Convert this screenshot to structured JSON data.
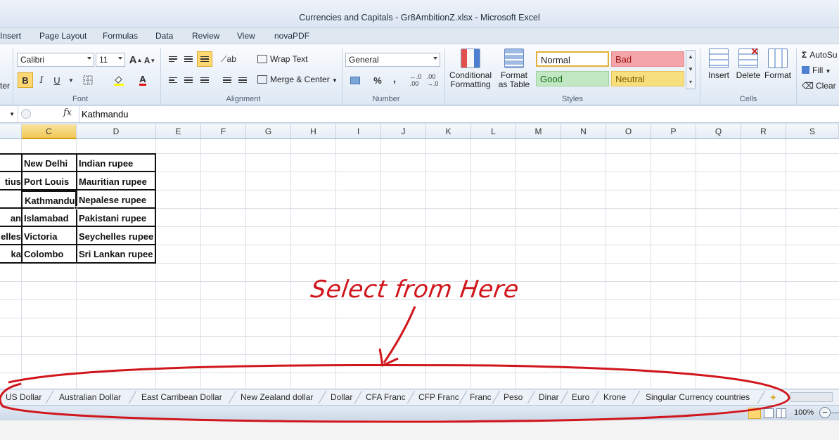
{
  "window": {
    "title": "Currencies and Capitals - Gr8AmbitionZ.xlsx -  Microsoft Excel"
  },
  "tabs": [
    "Insert",
    "Page Layout",
    "Formulas",
    "Data",
    "Review",
    "View",
    "novaPDF"
  ],
  "ribbon": {
    "clipboard_partial": "ter",
    "font": {
      "name": "Calibri",
      "size": "11",
      "group_label": "Font",
      "grow_label": "A",
      "shrink_label": "A",
      "bold": "B",
      "italic": "I",
      "underline": "U",
      "color_letter": "A"
    },
    "alignment": {
      "wrap_text": "Wrap Text",
      "merge_center": "Merge & Center",
      "group_label": "Alignment"
    },
    "number": {
      "format": "General",
      "percent": "%",
      "comma": ",",
      "group_label": "Number"
    },
    "styles": {
      "conditional_formatting": "Conditional\nFormatting",
      "format_as_table": "Format\nas Table",
      "normal": "Normal",
      "bad": "Bad",
      "good": "Good",
      "neutral": "Neutral",
      "group_label": "Styles"
    },
    "cells": {
      "insert": "Insert",
      "delete": "Delete",
      "format": "Format",
      "group_label": "Cells"
    },
    "editing": {
      "autosum": "AutoSu",
      "fill": "Fill",
      "clear": "Clear"
    }
  },
  "formula_bar": {
    "fx": "fx",
    "value": "Kathmandu"
  },
  "columns": [
    "C",
    "D",
    "E",
    "F",
    "G",
    "H",
    "I",
    "J",
    "K",
    "L",
    "M",
    "N",
    "O",
    "P",
    "Q",
    "R",
    "S"
  ],
  "selected_column": "C",
  "table": {
    "colB_partial": [
      "",
      "tius",
      "",
      "an",
      "elles",
      "ka"
    ],
    "capitals": [
      "New Delhi",
      "Port Louis",
      "Kathmandu",
      "Islamabad",
      "Victoria",
      "Colombo"
    ],
    "currencies": [
      "Indian rupee",
      "Mauritian rupee",
      "Nepalese rupee",
      "Pakistani rupee",
      "Seychelles rupee",
      "Sri Lankan rupee"
    ]
  },
  "annotation": {
    "text": "Select from Here",
    "color": "#d0161c"
  },
  "sheet_tabs": [
    "US Dollar",
    "Australian Dollar",
    "East Carribean Dollar",
    "New Zealand dollar",
    "Dollar",
    "CFA Franc",
    "CFP Franc",
    "Franc",
    "Peso",
    "Dinar",
    "Euro",
    "Krone",
    "Singular Currency countries"
  ],
  "status": {
    "zoom": "100%",
    "zoom_out": "−"
  },
  "colors": {
    "selected_header": "#f2c957",
    "normal_style_border": "#e2b13a",
    "bad": "#f4a5aa",
    "good": "#c2e7c3",
    "neutral": "#f8df7e"
  }
}
